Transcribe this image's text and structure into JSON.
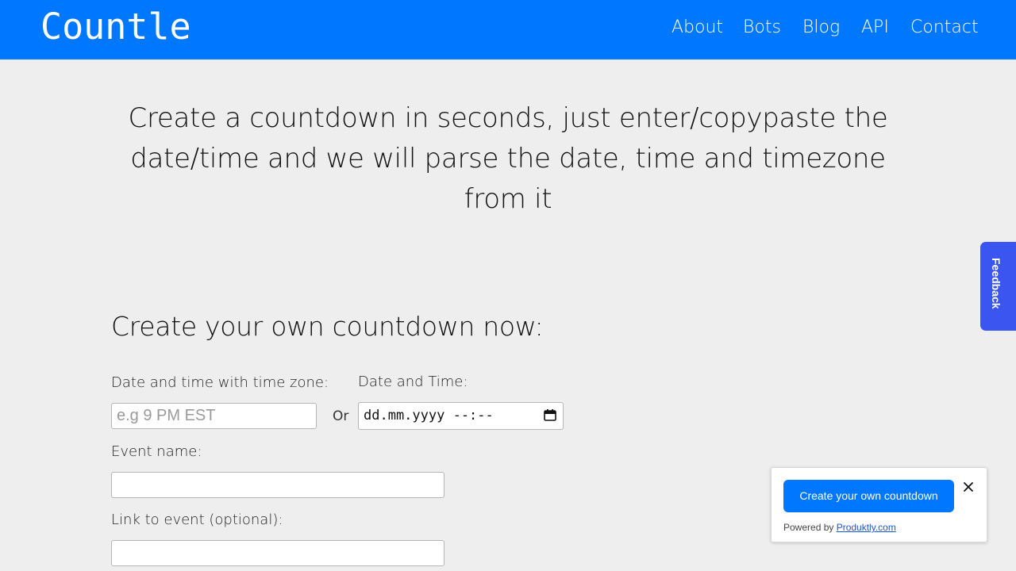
{
  "header": {
    "logo": "Countle",
    "nav": [
      {
        "label": "About"
      },
      {
        "label": "Bots"
      },
      {
        "label": "Blog"
      },
      {
        "label": "API"
      },
      {
        "label": "Contact"
      }
    ]
  },
  "hero": {
    "text_line1": "Create a countdown in seconds, just enter/copypaste the",
    "text_line2": "date/time and we will parse the date, time and timezone",
    "text_line3": "from it"
  },
  "feedback_tab": {
    "label": "Feedback"
  },
  "form": {
    "title": "Create your own countdown now:",
    "tz_label": "Date and time with time zone:",
    "tz_placeholder": "e.g 9 PM EST",
    "or_text": "Or",
    "dt_label": "Date and Time:",
    "dt_value": "dd.mm.yyyy --:--",
    "event_label": "Event name:",
    "event_value": "",
    "link_label": "Link to event (optional):",
    "link_value": ""
  },
  "popup": {
    "button_label": "Create your own countdown",
    "powered_prefix": "Powered by ",
    "powered_link": "Produktly.com"
  },
  "colors": {
    "brand": "#0077ff",
    "feedback": "#3a55f0",
    "background": "#eeeeee"
  }
}
